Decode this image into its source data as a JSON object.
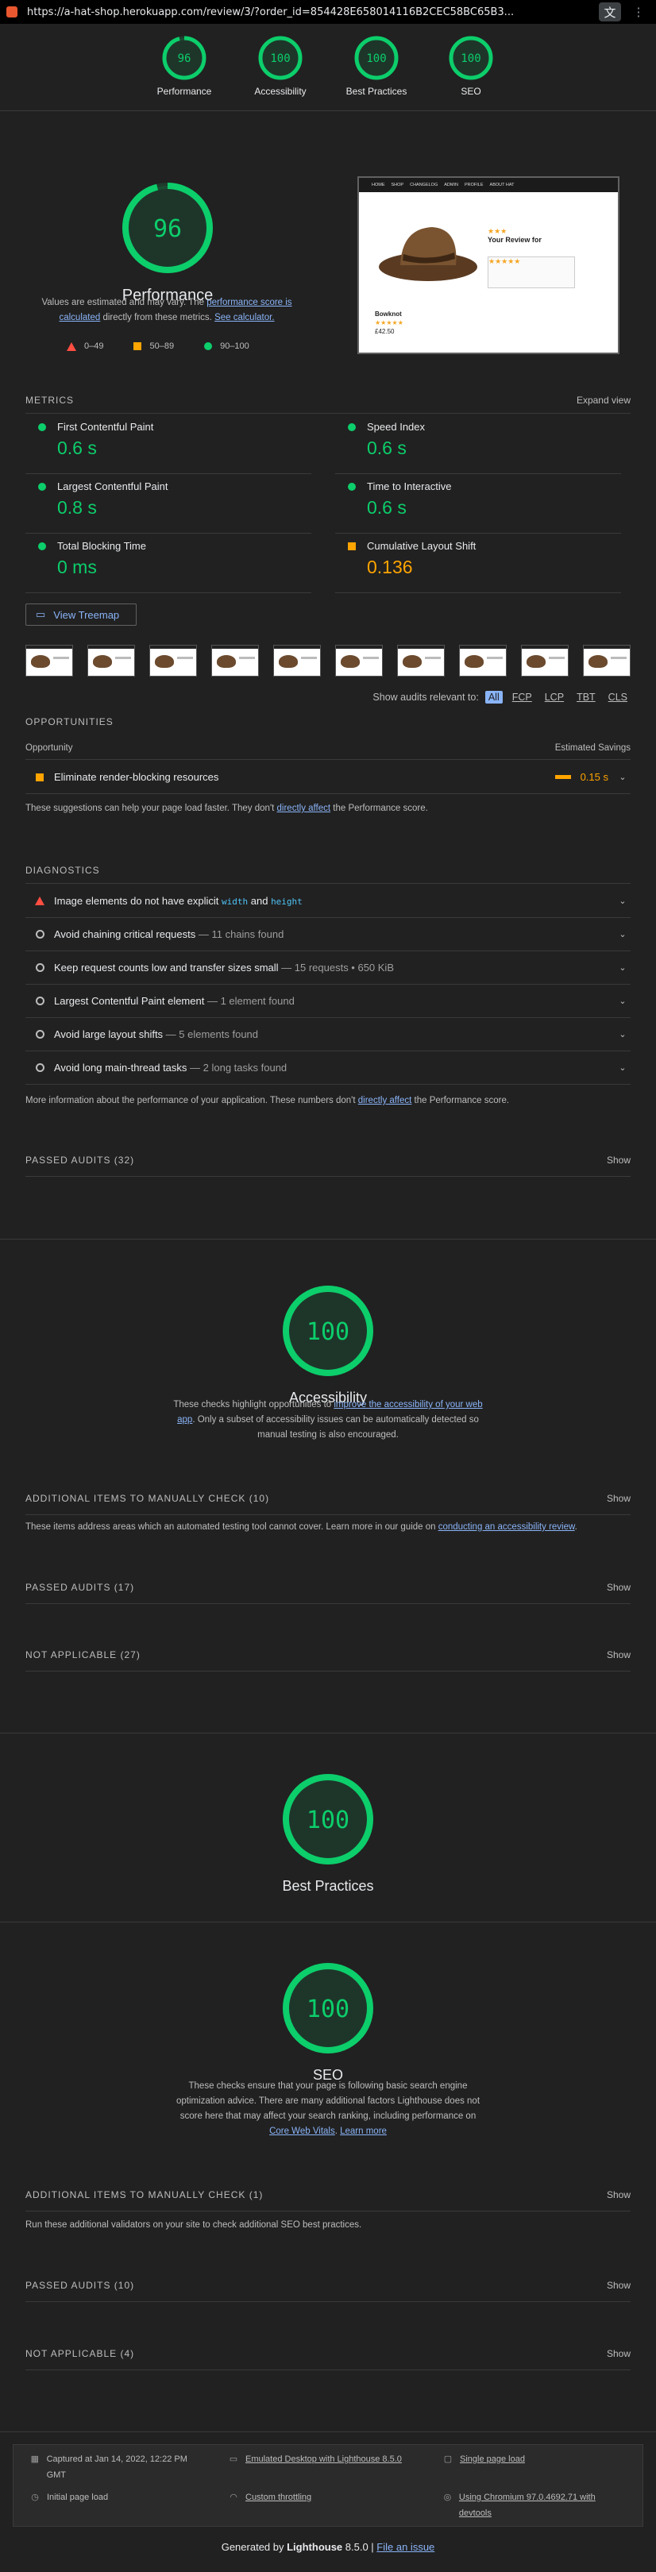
{
  "browser": {
    "url": "https://a-hat-shop.herokuapp.com/review/3/?order_id=854428E658014116B2CEC58BC65B3..."
  },
  "summary_gauges": [
    {
      "label": "Performance",
      "score": "96"
    },
    {
      "label": "Accessibility",
      "score": "100"
    },
    {
      "label": "Best Practices",
      "score": "100"
    },
    {
      "label": "SEO",
      "score": "100"
    }
  ],
  "performance": {
    "score": "96",
    "score_fraction": 0.96,
    "title": "Performance",
    "desc_before": "Values are estimated and may vary. The ",
    "desc_link1": "performance score is calculated",
    "desc_middle": " directly from these metrics. ",
    "desc_link2": "See calculator.",
    "legend": [
      "0–49",
      "50–89",
      "90–100"
    ],
    "screenshot": {
      "nav_items": [
        "HOME",
        "SHOP",
        "CHANGELOG",
        "ADMIN",
        "PROFILE",
        "ABOUT HAT"
      ],
      "review_title": "Your Review for",
      "product_name": "Bowknot",
      "price": "£42.50"
    }
  },
  "metrics": {
    "title": "METRICS",
    "expand": "Expand view",
    "items": [
      {
        "name": "First Contentful Paint",
        "value": "0.6 s",
        "status": "green"
      },
      {
        "name": "Speed Index",
        "value": "0.6 s",
        "status": "green"
      },
      {
        "name": "Largest Contentful Paint",
        "value": "0.8 s",
        "status": "green"
      },
      {
        "name": "Time to Interactive",
        "value": "0.6 s",
        "status": "green"
      },
      {
        "name": "Total Blocking Time",
        "value": "0 ms",
        "status": "green"
      },
      {
        "name": "Cumulative Layout Shift",
        "value": "0.136",
        "status": "orange"
      }
    ]
  },
  "treemap_label": "View Treemap",
  "filters": {
    "label": "Show audits relevant to:",
    "items": [
      "All",
      "FCP",
      "LCP",
      "TBT",
      "CLS"
    ]
  },
  "opportunities": {
    "title": "OPPORTUNITIES",
    "col_left": "Opportunity",
    "col_right": "Estimated Savings",
    "items": [
      {
        "title": "Eliminate render-blocking resources",
        "savings": "0.15 s"
      }
    ],
    "note_before": "These suggestions can help your page load faster. They don't ",
    "note_link": "directly affect",
    "note_after": " the Performance score."
  },
  "diagnostics": {
    "title": "DIAGNOSTICS",
    "item0": {
      "before": "Image elements do not have explicit ",
      "code1": "width",
      "and": " and ",
      "code2": "height"
    },
    "items": [
      {
        "title": "Avoid chaining critical requests",
        "sub": " — 11 chains found"
      },
      {
        "title": "Keep request counts low and transfer sizes small",
        "sub": " — 15 requests • 650 KiB"
      },
      {
        "title": "Largest Contentful Paint element",
        "sub": " — 1 element found"
      },
      {
        "title": "Avoid large layout shifts",
        "sub": " — 5 elements found"
      },
      {
        "title": "Avoid long main-thread tasks",
        "sub": " — 2 long tasks found"
      }
    ],
    "note_before": "More information about the performance of your application. These numbers don't ",
    "note_link": "directly affect",
    "note_after": " the Performance score."
  },
  "perf_passed": {
    "label": "PASSED AUDITS (32)",
    "show": "Show"
  },
  "accessibility": {
    "score": "100",
    "title": "Accessibility",
    "desc_before": "These checks highlight opportunities to ",
    "desc_link": "improve the accessibility of your web app",
    "desc_after": ". Only a subset of accessibility issues can be automatically detected so manual testing is also encouraged.",
    "manual": {
      "label": "ADDITIONAL ITEMS TO MANUALLY CHECK (10)",
      "show": "Show"
    },
    "manual_note_before": "These items address areas which an automated testing tool cannot cover. Learn more in our guide on ",
    "manual_note_link": "conducting an accessibility review",
    "manual_note_after": ".",
    "passed": {
      "label": "PASSED AUDITS (17)",
      "show": "Show"
    },
    "na": {
      "label": "NOT APPLICABLE (27)",
      "show": "Show"
    }
  },
  "best_practices": {
    "score": "100",
    "title": "Best Practices"
  },
  "seo": {
    "score": "100",
    "title": "SEO",
    "desc_before": "These checks ensure that your page is following basic search engine optimization advice. There are many additional factors Lighthouse does not score here that may affect your search ranking, including performance on ",
    "desc_link1": "Core Web Vitals",
    "desc_mid": ". ",
    "desc_link2": "Learn more",
    "manual": {
      "label": "ADDITIONAL ITEMS TO MANUALLY CHECK (1)",
      "show": "Show"
    },
    "manual_note": "Run these additional validators on your site to check additional SEO best practices.",
    "passed": {
      "label": "PASSED AUDITS (10)",
      "show": "Show"
    },
    "na": {
      "label": "NOT APPLICABLE (4)",
      "show": "Show"
    }
  },
  "footer": {
    "captured": "Captured at Jan 14, 2022, 12:22 PM GMT",
    "emulated": "Emulated Desktop with Lighthouse 8.5.0",
    "single": "Single page load",
    "initial": "Initial page load",
    "throttling": "Custom throttling",
    "chromium": "Using Chromium 97.0.4692.71 with devtools",
    "generated_prefix": "Generated by ",
    "generated_brand": "Lighthouse",
    "generated_version": " 8.5.0 | ",
    "issue_link": "File an issue"
  },
  "colors": {
    "pass": "#0cce6b",
    "average": "#ffa400",
    "fail": "#ff4e42",
    "link": "#8ab4f8"
  }
}
